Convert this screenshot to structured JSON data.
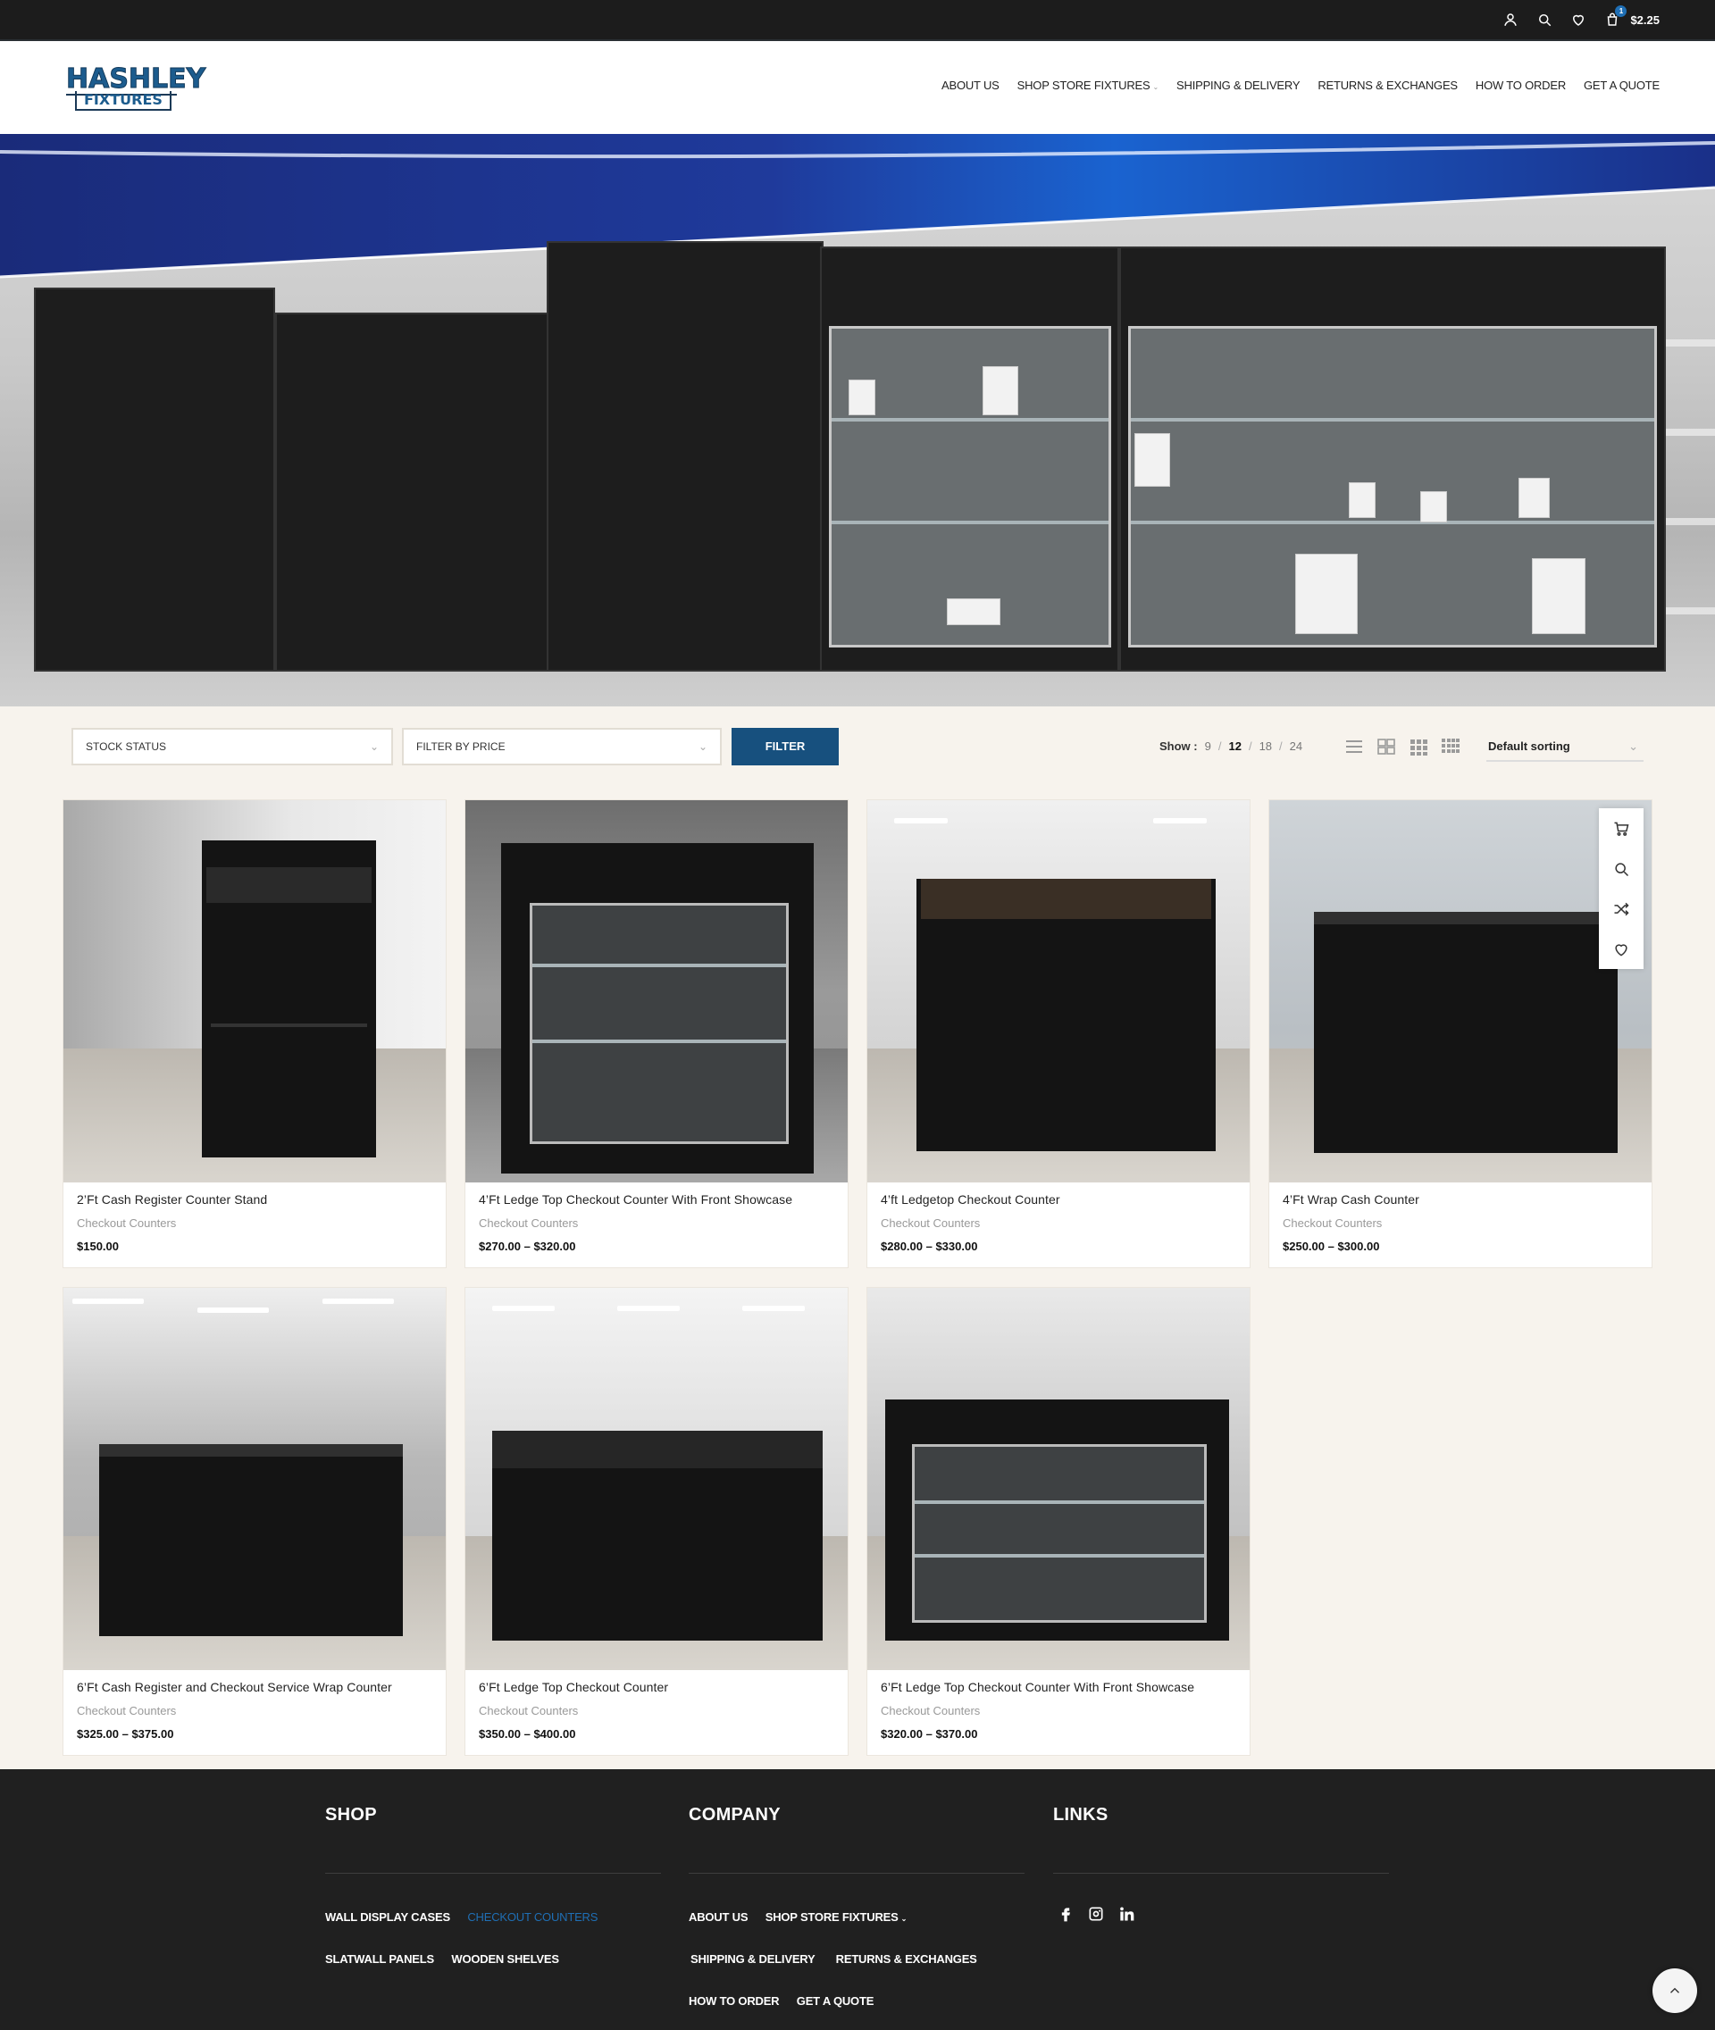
{
  "topbar": {
    "cart_count": "1",
    "cart_total": "$2.25",
    "icons": [
      "user-icon",
      "search-icon",
      "heart-icon",
      "cart-icon"
    ]
  },
  "header": {
    "logo_line1": "HASHLEY",
    "logo_line2": "FIXTURES",
    "nav": [
      {
        "label": "ABOUT US"
      },
      {
        "label": "SHOP STORE FIXTURES",
        "has_dropdown": true
      },
      {
        "label": "SHIPPING & DELIVERY"
      },
      {
        "label": "RETURNS & EXCHANGES"
      },
      {
        "label": "HOW TO ORDER"
      },
      {
        "label": "GET A QUOTE"
      }
    ]
  },
  "toolbar": {
    "stock_status": "STOCK STATUS",
    "filter_price": "FILTER BY PRICE",
    "filter_button": "FILTER",
    "show_label": "Show :",
    "show_options": [
      "9",
      "12",
      "18",
      "24"
    ],
    "show_active": "12",
    "sorting": "Default sorting"
  },
  "products": [
    {
      "title": "2’Ft Cash Register Counter Stand",
      "category": "Checkout Counters",
      "price": "$150.00"
    },
    {
      "title": "4’Ft Ledge Top Checkout Counter With Front Showcase",
      "category": "Checkout Counters",
      "price": "$270.00 – $320.00"
    },
    {
      "title": "4’ft Ledgetop Checkout Counter",
      "category": "Checkout Counters",
      "price": "$280.00 – $330.00"
    },
    {
      "title": "4’Ft Wrap Cash Counter",
      "category": "Checkout Counters",
      "price": "$250.00 – $300.00"
    },
    {
      "title": "6’Ft Cash Register and Checkout Service Wrap Counter",
      "category": "Checkout Counters",
      "price": "$325.00 – $375.00"
    },
    {
      "title": "6’Ft Ledge Top Checkout Counter",
      "category": "Checkout Counters",
      "price": "$350.00 – $400.00"
    },
    {
      "title": "6’Ft Ledge Top Checkout Counter With Front Showcase",
      "category": "Checkout Counters",
      "price": "$320.00 – $370.00"
    }
  ],
  "footer": {
    "shop": {
      "heading": "SHOP",
      "links": [
        "WALL DISPLAY CASES",
        "CHECKOUT COUNTERS",
        "SLATWALL PANELS",
        "WOODEN SHELVES"
      ]
    },
    "company": {
      "heading": "COMPANY",
      "links": [
        "ABOUT US",
        "SHOP STORE FIXTURES",
        "SHIPPING & DELIVERY",
        "RETURNS & EXCHANGES",
        "HOW TO ORDER",
        "GET A QUOTE"
      ]
    },
    "links": {
      "heading": "LINKS",
      "social": [
        "facebook-icon",
        "instagram-icon",
        "linkedin-icon"
      ]
    }
  },
  "colors": {
    "accent": "#1f6fb5",
    "filter_button": "#17507e",
    "topbar": "#1c1c1c",
    "footer": "#202020",
    "page_bg": "#f7f3ed"
  }
}
